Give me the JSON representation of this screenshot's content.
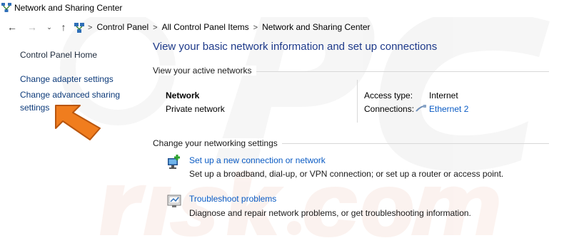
{
  "window": {
    "title": "Network and Sharing Center"
  },
  "addressbar": {
    "back_icon": "back-arrow-icon",
    "forward_icon": "forward-arrow-icon",
    "recent_icon": "chevron-down-icon",
    "up_icon": "up-arrow-icon",
    "crumbs": [
      "Control Panel",
      "All Control Panel Items",
      "Network and Sharing Center"
    ],
    "separator": ">"
  },
  "sidebar": {
    "home": "Control Panel Home",
    "items": [
      {
        "label": "Change adapter settings"
      },
      {
        "label": "Change advanced sharing settings"
      }
    ]
  },
  "main": {
    "heading": "View your basic network information and set up connections",
    "active_section": "View your active networks",
    "network": {
      "name": "Network",
      "type": "Private network",
      "access_type_label": "Access type:",
      "access_type_value": "Internet",
      "connections_label": "Connections:",
      "connection_name": "Ethernet 2"
    },
    "change_section": "Change your networking settings",
    "tasks": [
      {
        "icon": "new-connection-icon",
        "link": "Set up a new connection or network",
        "description": "Set up a broadband, dial-up, or VPN connection; or set up a router or access point."
      },
      {
        "icon": "troubleshoot-icon",
        "link": "Troubleshoot problems",
        "description": "Diagnose and repair network problems, or get troubleshooting information."
      }
    ]
  },
  "annotation": {
    "arrow_color": "#f07d1e"
  },
  "colors": {
    "link": "#0a5bc4",
    "heading": "#1e3a8a"
  }
}
